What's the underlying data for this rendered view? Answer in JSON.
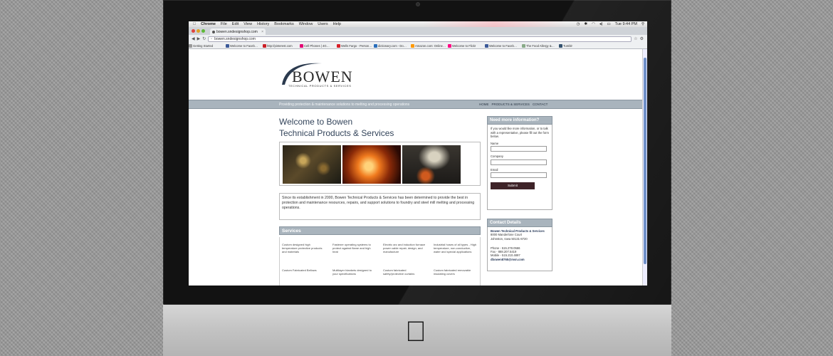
{
  "menubar": {
    "items": [
      "Chrome",
      "File",
      "Edit",
      "View",
      "History",
      "Bookmarks",
      "Window",
      "Users",
      "Help"
    ],
    "clock": "Tue 9:44 PM"
  },
  "browser": {
    "tab_title": "bowen.sndesignshop.com",
    "url": "bowen.sndesignshop.com",
    "bookmarks": [
      "Getting Started",
      "Welcome to Faceb…",
      "http://pinterest.com",
      "Cell Phones | 4G…",
      "Wells Fargo - Person…",
      "dictionary.com - Do…",
      "Amazon.com: Online…",
      "Welcome to Flickr",
      "Welcome to Faceb…",
      "The Food Allergy &…",
      "Tumblr"
    ]
  },
  "site": {
    "logo": "BOWEN",
    "logo_sub": "TECHNICAL PRODUCTS & SERVICES",
    "tagline": "Providing protection & maintenance solutions to melting and processing operations",
    "nav": [
      "HOME",
      "PRODUCTS & SERVICES",
      "CONTACT"
    ],
    "heading_1": "Welcome to Bowen",
    "heading_2": "Technical Products & Services",
    "intro": "Since its establishment in 2000, Bowen Technical Products & Services has been determined to provide the best in protection and maintenance resources, repairs, and support solutions to foundry and steel mill melting and processing operations.",
    "services_title": "Services",
    "services": [
      "Custom designed high temperature protective products and materials",
      "Fastener operating systems to protect against flame and high heat",
      "Electric arc and induction furnace power cable repair, design, and manufacture",
      "Industrial hoses of all types - High temperature, non-conductive, water and special applications",
      "Custom Fabricated Bellows",
      "Multilayer blankets designed to your specifications",
      "Custom fabricated safety/protective curtains",
      "Custom fabricated removable insulating covers"
    ],
    "sidebar": {
      "info_title": "Need more information?",
      "info_text": "If you would like more information, or to talk with a representative, please fill out the form below.",
      "name_label": "Name",
      "company_label": "Company",
      "email_label": "Email",
      "submit": "Submit",
      "contact_title": "Contact Details",
      "company_name": "Bowen Technical Products & Services",
      "address_1": "8000 Manderlone Court",
      "address_2": "Johnston, Iowa 50131-8720",
      "phone": "Phone - 515.278.0566",
      "fax": "Fax - 888.207.5419",
      "mobile": "Mobile - 515.210.4897",
      "email": "dbowen8765@msn.com"
    }
  },
  "colors": {
    "nav_bar": "#a9b4bd",
    "heading": "#33445a",
    "submit_button": "#3e2328"
  }
}
